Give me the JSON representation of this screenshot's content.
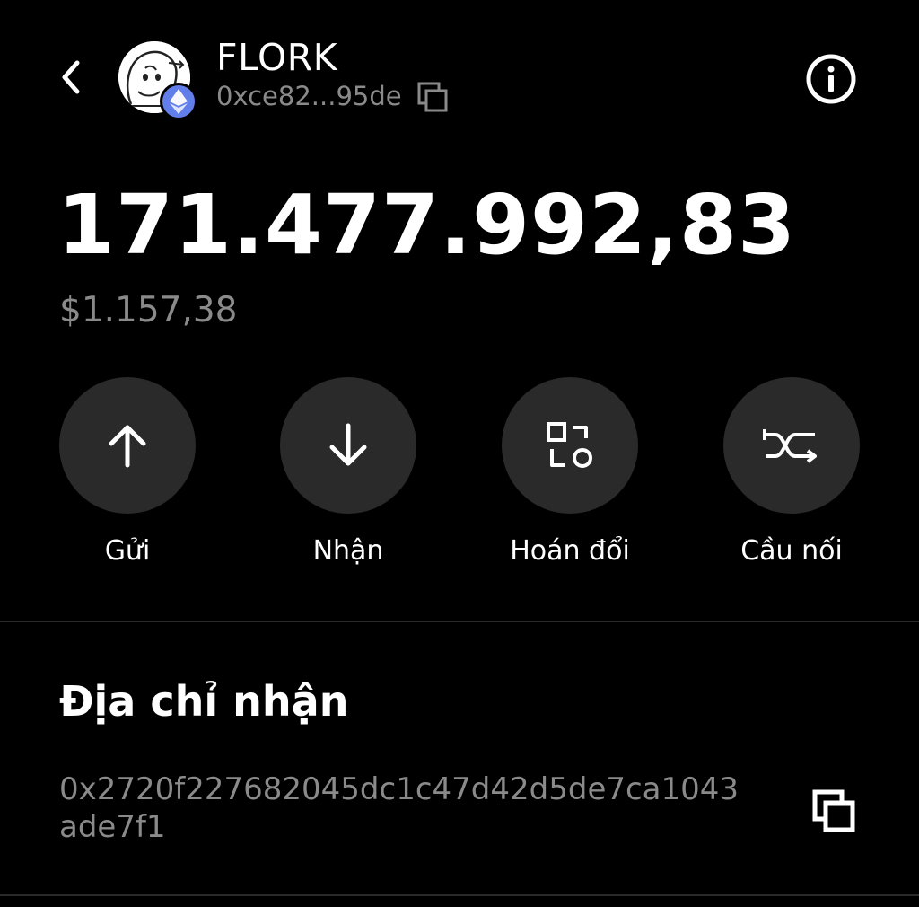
{
  "header": {
    "token_name": "FLORK",
    "token_address_short": "0xce82...95de",
    "chain": "ethereum"
  },
  "balance": {
    "amount": "171.477.992,83",
    "fiat": "$1.157,38"
  },
  "actions": [
    {
      "label": "Gửi",
      "icon": "arrow-up-icon"
    },
    {
      "label": "Nhận",
      "icon": "arrow-down-icon"
    },
    {
      "label": "Hoán đổi",
      "icon": "swap-icon"
    },
    {
      "label": "Cầu nối",
      "icon": "bridge-icon"
    }
  ],
  "receive": {
    "title": "Địa chỉ nhận",
    "address_line1": "0x2720f227682045dc1c47d42d5de7ca1043",
    "address_line2": "ade7f1"
  },
  "colors": {
    "background": "#000000",
    "button_bg": "#2a2a2a",
    "muted_text": "#8a8a8a",
    "eth_badge": "#627eea"
  }
}
